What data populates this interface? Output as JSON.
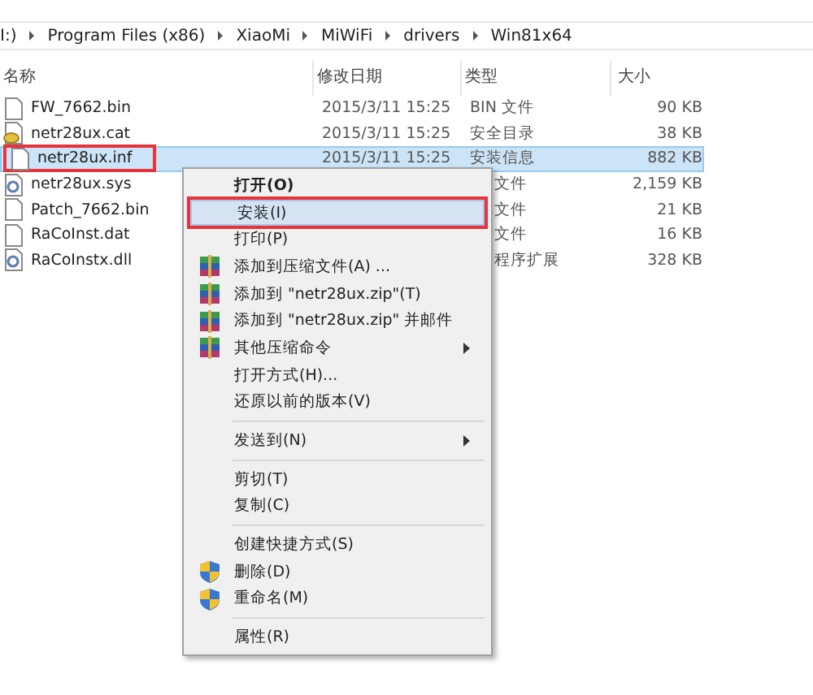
{
  "address_bar": {
    "segments": [
      "I:)",
      "Program Files (x86)",
      "XiaoMi",
      "MiWiFi",
      "drivers",
      "Win81x64"
    ]
  },
  "table": {
    "columns": [
      "名称",
      "修改日期",
      "类型",
      "大小"
    ],
    "rows": [
      {
        "kind": "file",
        "name": "FW_7662.bin",
        "date": "2015/3/11 15:25",
        "type": "BIN 文件",
        "size": "90 KB",
        "selected": false,
        "marked": false
      },
      {
        "kind": "certificate",
        "name": "netr28ux.cat",
        "date": "2015/3/11 15:25",
        "type": "安全目录",
        "size": "38 KB",
        "selected": false,
        "marked": false
      },
      {
        "kind": "file",
        "name": "netr28ux.inf",
        "date": "2015/3/11 15:25",
        "type": "安装信息",
        "size": "882 KB",
        "selected": true,
        "marked": true
      },
      {
        "kind": "system",
        "name": "netr28ux.sys",
        "type": "文件",
        "size": "2,159 KB",
        "selected": false,
        "marked": false
      },
      {
        "kind": "file",
        "name": "Patch_7662.bin",
        "type": "文件",
        "size": "21 KB",
        "selected": false,
        "marked": false
      },
      {
        "kind": "file",
        "name": "RaCoInst.dat",
        "type": "文件",
        "size": "16 KB",
        "selected": false,
        "marked": false
      },
      {
        "kind": "system",
        "name": "RaCoInstx.dll",
        "type": "程序扩展",
        "size": "328 KB",
        "selected": false,
        "marked": false
      }
    ]
  },
  "context_menu": {
    "items": [
      {
        "kind": "plain",
        "label": "打开(O)",
        "bold": true,
        "submenu": false,
        "selected": false,
        "marked": false
      },
      {
        "kind": "plain",
        "label": "安装(I)",
        "bold": false,
        "submenu": false,
        "selected": true,
        "marked": true
      },
      {
        "kind": "plain",
        "label": "打印(P)",
        "bold": false,
        "submenu": false,
        "selected": false,
        "marked": false
      },
      {
        "kind": "archive",
        "label": "添加到压缩文件(A) ...",
        "bold": false,
        "submenu": false,
        "selected": false,
        "marked": false
      },
      {
        "kind": "archive",
        "label": "添加到 \"netr28ux.zip\"(T)",
        "bold": false,
        "submenu": false,
        "selected": false,
        "marked": false
      },
      {
        "kind": "archive",
        "label": "添加到 \"netr28ux.zip\" 并邮件",
        "bold": false,
        "submenu": false,
        "selected": false,
        "marked": false
      },
      {
        "kind": "archive",
        "label": "其他压缩命令",
        "bold": false,
        "submenu": true,
        "selected": false,
        "marked": false
      },
      {
        "kind": "plain",
        "label": "打开方式(H)...",
        "bold": false,
        "submenu": false,
        "selected": false,
        "marked": false
      },
      {
        "kind": "plain",
        "label": "还原以前的版本(V)",
        "bold": false,
        "submenu": false,
        "selected": false,
        "marked": false
      },
      {
        "kind": "separator"
      },
      {
        "kind": "plain",
        "label": "发送到(N)",
        "bold": false,
        "submenu": true,
        "selected": false,
        "marked": false
      },
      {
        "kind": "separator"
      },
      {
        "kind": "plain",
        "label": "剪切(T)",
        "bold": false,
        "submenu": false,
        "selected": false,
        "marked": false
      },
      {
        "kind": "plain",
        "label": "复制(C)",
        "bold": false,
        "submenu": false,
        "selected": false,
        "marked": false
      },
      {
        "kind": "separator"
      },
      {
        "kind": "plain",
        "label": "创建快捷方式(S)",
        "bold": false,
        "submenu": false,
        "selected": false,
        "marked": false
      },
      {
        "kind": "shield",
        "label": "删除(D)",
        "bold": false,
        "submenu": false,
        "selected": false,
        "marked": false
      },
      {
        "kind": "shield",
        "label": "重命名(M)",
        "bold": false,
        "submenu": false,
        "selected": false,
        "marked": false
      },
      {
        "kind": "separator"
      },
      {
        "kind": "plain",
        "label": "属性(R)",
        "bold": false,
        "submenu": false,
        "selected": false,
        "marked": false
      }
    ]
  }
}
